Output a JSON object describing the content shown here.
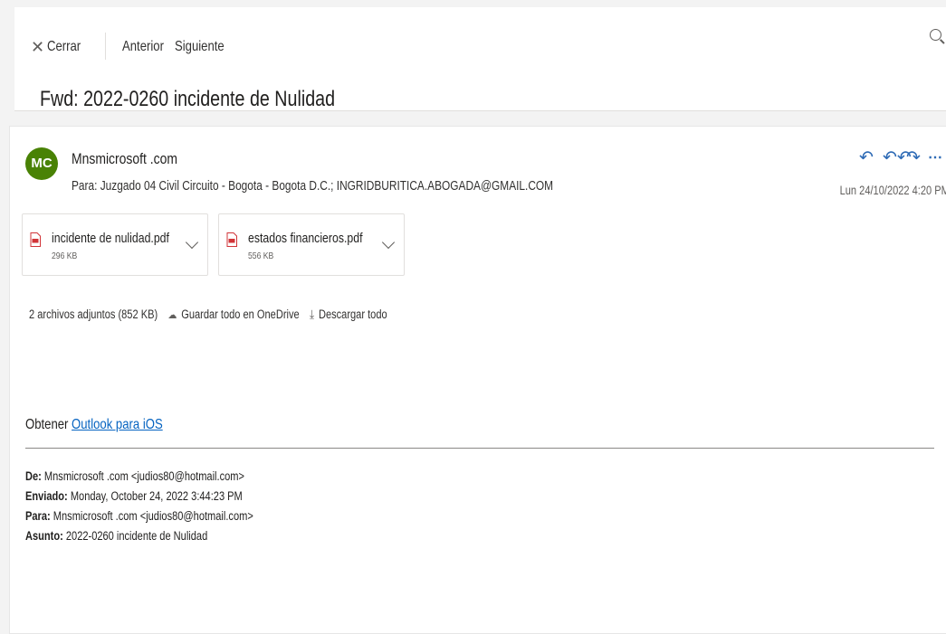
{
  "toolbar": {
    "close_icon": "✕",
    "close_label": "Cerrar",
    "prev_label": "Anterior",
    "next_label": "Siguiente",
    "zoom_icon": "zoom-in-icon"
  },
  "subject": "Fwd: 2022-0260 incidente de Nulidad",
  "message": {
    "avatar_initials": "MC",
    "avatar_color": "#498205",
    "sender": "Mnsmicrosoft .com",
    "recipients": "Para:  Juzgado 04 Civil Circuito - Bogota - Bogota D.C.;  INGRIDBURITICA.ABOGADA@GMAIL.COM",
    "date": "Lun 24/10/2022 4:20 PM",
    "actions": {
      "reply_icon": "↶",
      "reply_all_icon": "↶↶",
      "forward_icon": "↷",
      "more_icon": "⋯"
    }
  },
  "attachments": [
    {
      "name": "incidente de nulidad.pdf",
      "size": "296 KB"
    },
    {
      "name": "estados financieros.pdf",
      "size": "556 KB"
    }
  ],
  "attachment_summary": {
    "count_text": "2 archivos adjuntos (852 KB)",
    "save_onedrive": "Guardar todo en OneDrive",
    "download_all": "Descargar todo"
  },
  "body": {
    "get_prefix": "Obtener ",
    "outlook_link": "Outlook para iOS",
    "forward_header": {
      "from_label": "De:",
      "from_value": " Mnsmicrosoft .com <judios80@hotmail.com>",
      "sent_label": "Enviado:",
      "sent_value": " Monday, October 24, 2022 3:44:23 PM",
      "to_label": "Para:",
      "to_value": " Mnsmicrosoft .com <judios80@hotmail.com>",
      "subject_label": "Asunto:",
      "subject_value": " 2022-0260 incidente de Nulidad"
    }
  },
  "colors": {
    "accent": "#2d6ab5",
    "link": "#0563c1",
    "pdf_red": "#d13438"
  }
}
